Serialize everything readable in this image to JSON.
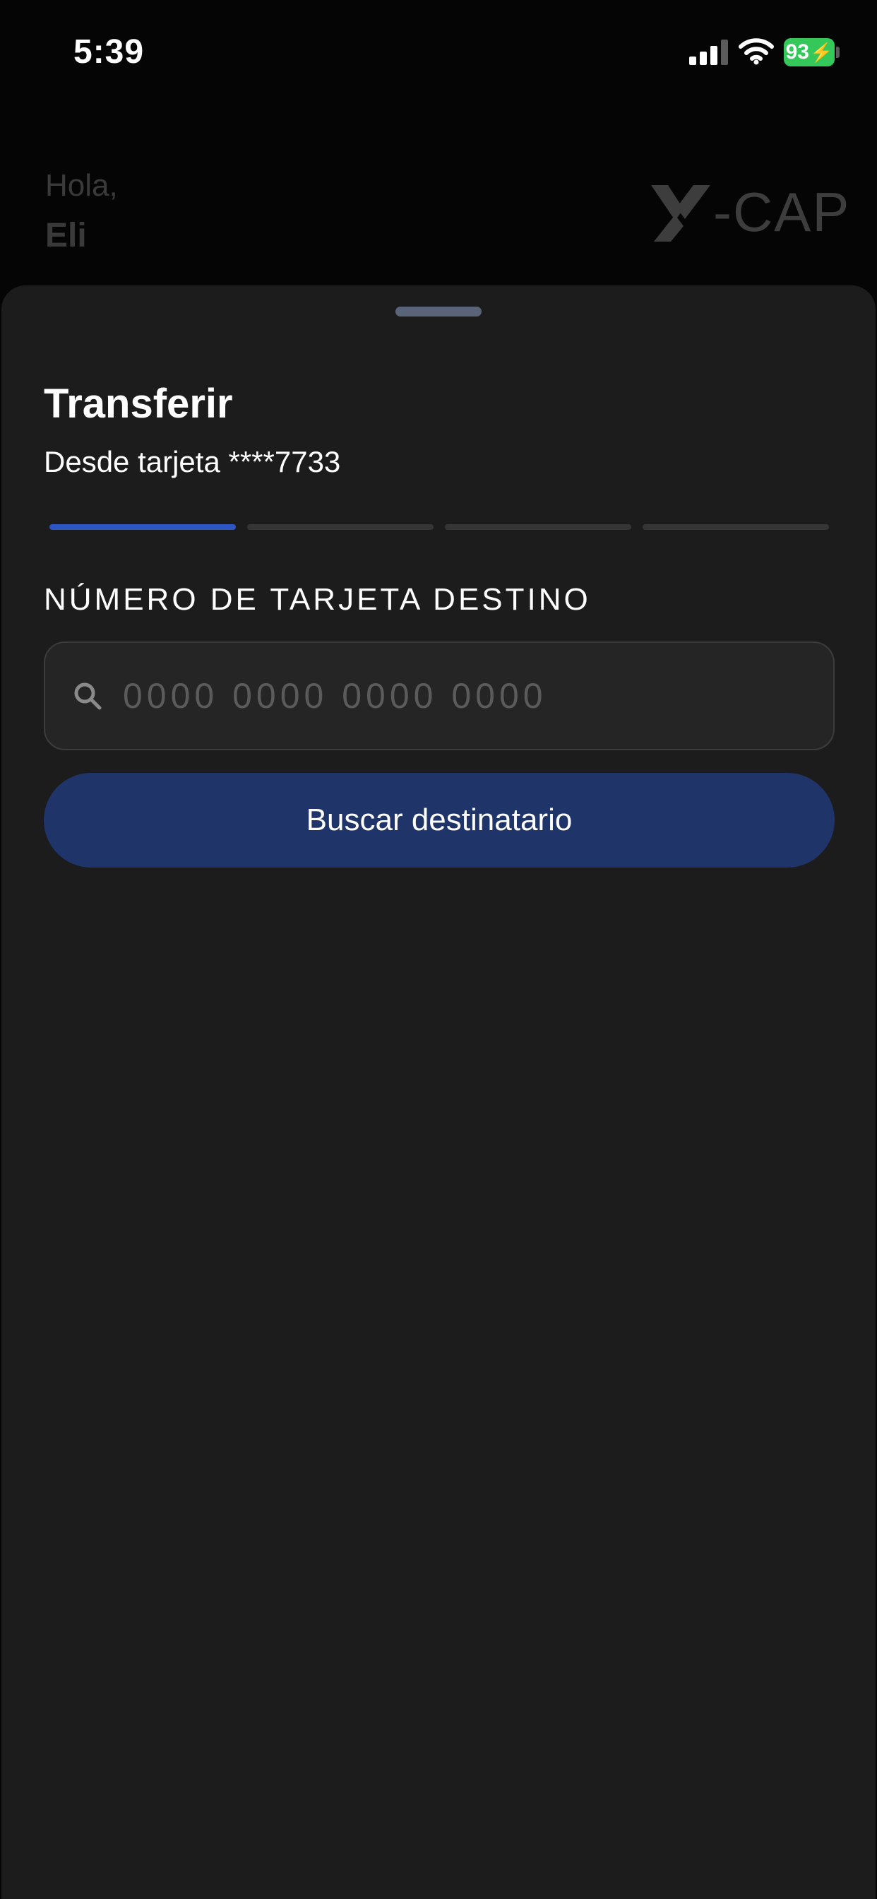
{
  "status_bar": {
    "time": "5:39",
    "battery": "93",
    "battery_color": "#34c759",
    "icons": [
      "signal-icon",
      "wifi-icon",
      "battery-icon",
      "bolt-icon"
    ]
  },
  "header": {
    "greeting": "Hola,",
    "name": "Eli",
    "logo_text": "-CAP",
    "logo_icon": "x-logo-icon"
  },
  "sheet": {
    "title": "Transferir",
    "subtitle": "Desde tarjeta ****7733",
    "steps_total": 4,
    "steps_active": 1,
    "accent_color": "#2c56c4",
    "field_label": "NÚMERO DE TARJETA DESTINO",
    "search": {
      "placeholder": "0000 0000 0000 0000",
      "value": "",
      "icon": "search-icon"
    },
    "button_label": "Buscar destinatario",
    "button_color": "#1f356a"
  }
}
